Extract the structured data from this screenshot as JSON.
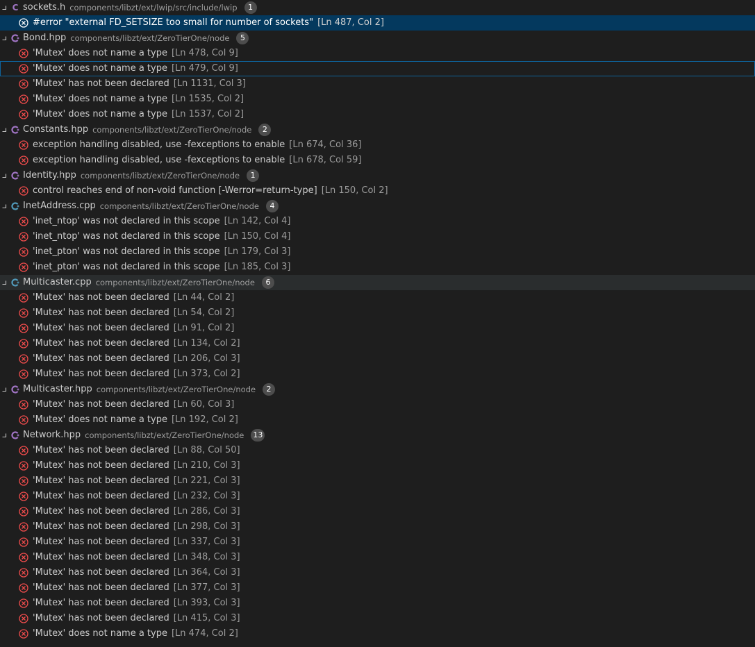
{
  "colors": {
    "error": "#f14c4c",
    "selected_background": "#04395e",
    "background": "#1e1e1e"
  },
  "groups": [
    {
      "file": "sockets.h",
      "path": "components/libzt/ext/lwip/src/include/lwip",
      "count": "1",
      "icon": "c-file-icon",
      "problems": [
        {
          "message": "#error \"external FD_SETSIZE too small for number of sockets\"",
          "location": "[Ln 487, Col 2]"
        }
      ]
    },
    {
      "file": "Bond.hpp",
      "path": "components/libzt/ext/ZeroTierOne/node",
      "count": "5",
      "icon": "cpp-header-icon",
      "problems": [
        {
          "message": "'Mutex' does not name a type",
          "location": "[Ln 478, Col 9]"
        },
        {
          "message": "'Mutex' does not name a type",
          "location": "[Ln 479, Col 9]"
        },
        {
          "message": "'Mutex' has not been declared",
          "location": "[Ln 1131, Col 3]"
        },
        {
          "message": "'Mutex' does not name a type",
          "location": "[Ln 1535, Col 2]"
        },
        {
          "message": "'Mutex' does not name a type",
          "location": "[Ln 1537, Col 2]"
        }
      ]
    },
    {
      "file": "Constants.hpp",
      "path": "components/libzt/ext/ZeroTierOne/node",
      "count": "2",
      "icon": "cpp-header-icon",
      "problems": [
        {
          "message": "exception handling disabled, use -fexceptions to enable",
          "location": "[Ln 674, Col 36]"
        },
        {
          "message": "exception handling disabled, use -fexceptions to enable",
          "location": "[Ln 678, Col 59]"
        }
      ]
    },
    {
      "file": "Identity.hpp",
      "path": "components/libzt/ext/ZeroTierOne/node",
      "count": "1",
      "icon": "cpp-header-icon",
      "problems": [
        {
          "message": "control reaches end of non-void function [-Werror=return-type]",
          "location": "[Ln 150, Col 2]"
        }
      ]
    },
    {
      "file": "InetAddress.cpp",
      "path": "components/libzt/ext/ZeroTierOne/node",
      "count": "4",
      "icon": "cpp-source-icon",
      "problems": [
        {
          "message": "'inet_ntop' was not declared in this scope",
          "location": "[Ln 142, Col 4]"
        },
        {
          "message": "'inet_ntop' was not declared in this scope",
          "location": "[Ln 150, Col 4]"
        },
        {
          "message": "'inet_pton' was not declared in this scope",
          "location": "[Ln 179, Col 3]"
        },
        {
          "message": "'inet_pton' was not declared in this scope",
          "location": "[Ln 185, Col 3]"
        }
      ]
    },
    {
      "file": "Multicaster.cpp",
      "path": "components/libzt/ext/ZeroTierOne/node",
      "count": "6",
      "icon": "cpp-source-icon",
      "problems": [
        {
          "message": "'Mutex' has not been declared",
          "location": "[Ln 44, Col 2]"
        },
        {
          "message": "'Mutex' has not been declared",
          "location": "[Ln 54, Col 2]"
        },
        {
          "message": "'Mutex' has not been declared",
          "location": "[Ln 91, Col 2]"
        },
        {
          "message": "'Mutex' has not been declared",
          "location": "[Ln 134, Col 2]"
        },
        {
          "message": "'Mutex' has not been declared",
          "location": "[Ln 206, Col 3]"
        },
        {
          "message": "'Mutex' has not been declared",
          "location": "[Ln 373, Col 2]"
        }
      ]
    },
    {
      "file": "Multicaster.hpp",
      "path": "components/libzt/ext/ZeroTierOne/node",
      "count": "2",
      "icon": "cpp-header-icon",
      "problems": [
        {
          "message": "'Mutex' has not been declared",
          "location": "[Ln 60, Col 3]"
        },
        {
          "message": "'Mutex' does not name a type",
          "location": "[Ln 192, Col 2]"
        }
      ]
    },
    {
      "file": "Network.hpp",
      "path": "components/libzt/ext/ZeroTierOne/node",
      "count": "13",
      "icon": "cpp-header-icon",
      "problems": [
        {
          "message": "'Mutex' has not been declared",
          "location": "[Ln 88, Col 50]"
        },
        {
          "message": "'Mutex' has not been declared",
          "location": "[Ln 210, Col 3]"
        },
        {
          "message": "'Mutex' has not been declared",
          "location": "[Ln 221, Col 3]"
        },
        {
          "message": "'Mutex' has not been declared",
          "location": "[Ln 232, Col 3]"
        },
        {
          "message": "'Mutex' has not been declared",
          "location": "[Ln 286, Col 3]"
        },
        {
          "message": "'Mutex' has not been declared",
          "location": "[Ln 298, Col 3]"
        },
        {
          "message": "'Mutex' has not been declared",
          "location": "[Ln 337, Col 3]"
        },
        {
          "message": "'Mutex' has not been declared",
          "location": "[Ln 348, Col 3]"
        },
        {
          "message": "'Mutex' has not been declared",
          "location": "[Ln 364, Col 3]"
        },
        {
          "message": "'Mutex' has not been declared",
          "location": "[Ln 377, Col 3]"
        },
        {
          "message": "'Mutex' has not been declared",
          "location": "[Ln 393, Col 3]"
        },
        {
          "message": "'Mutex' has not been declared",
          "location": "[Ln 415, Col 3]"
        },
        {
          "message": "'Mutex' does not name a type",
          "location": "[Ln 474, Col 2]"
        }
      ]
    }
  ]
}
